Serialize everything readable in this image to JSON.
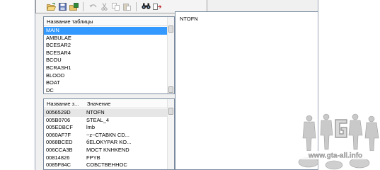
{
  "toolbar": {
    "icons": [
      "open-folder-icon",
      "save-icon",
      "save-all-icon",
      "undo-icon",
      "cut-icon",
      "copy-icon",
      "paste-icon",
      "find-icon",
      "replace-icon"
    ]
  },
  "tables_panel": {
    "header": "Название таблицы",
    "items": [
      "MAIN",
      "AMBULAE",
      "BCESAR2",
      "BCESAR4",
      "BCOU",
      "BCRASH1",
      "BLOOD",
      "BOAT",
      "DC"
    ],
    "selected_index": 0
  },
  "values_panel": {
    "header_name": "Название з...",
    "header_value": "Значение",
    "rows": [
      {
        "name": "0056529D",
        "value": "NTOFN"
      },
      {
        "name": "005B0706",
        "value": "STEAL_4"
      },
      {
        "name": "005EDBCF",
        "value": "lmb"
      },
      {
        "name": "0060AF7F",
        "value": "~z~СТАВКN CD..."
      },
      {
        "name": "0068BCED",
        "value": "бЕLOKYPAR KO..."
      },
      {
        "name": "006CCA3B",
        "value": "MOCT KNHKEND"
      },
      {
        "name": "00814826",
        "value": "FPYB"
      },
      {
        "name": "0085F84C",
        "value": "СОБСТВЕННОС"
      }
    ]
  },
  "editor": {
    "text": "NTOFN"
  },
  "watermark": {
    "text": "www.gta-all.info"
  }
}
